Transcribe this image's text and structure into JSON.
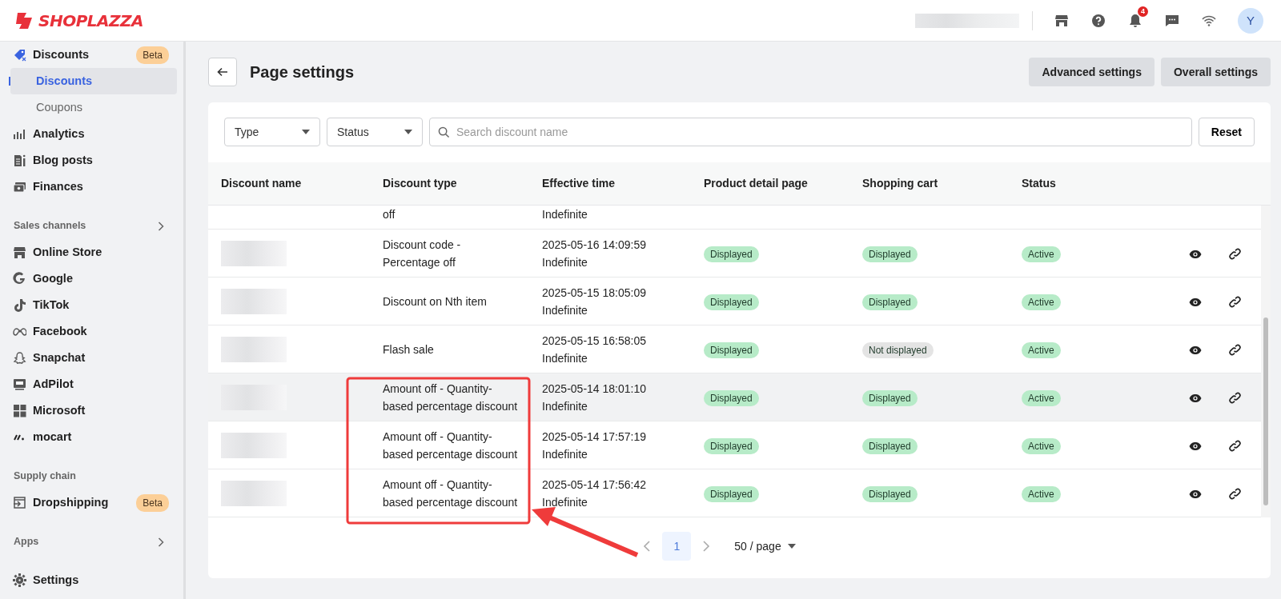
{
  "brand": {
    "name": "SHOPLAZZA"
  },
  "header": {
    "notification_count": "4",
    "avatar_initial": "Y"
  },
  "sidebar": {
    "items": [
      {
        "kind": "item",
        "label": "Discounts",
        "badge": "Beta",
        "selected": false
      },
      {
        "kind": "subitem",
        "label": "Discounts",
        "selected": true
      },
      {
        "kind": "subitem",
        "label": "Coupons",
        "selected": false
      },
      {
        "kind": "item",
        "label": "Analytics",
        "selected": false
      },
      {
        "kind": "item",
        "label": "Blog posts",
        "selected": false
      },
      {
        "kind": "item",
        "label": "Finances",
        "selected": false
      },
      {
        "kind": "section",
        "label": "Sales channels",
        "expandable": true
      },
      {
        "kind": "item",
        "label": "Online Store",
        "selected": false
      },
      {
        "kind": "item",
        "label": "Google",
        "selected": false
      },
      {
        "kind": "item",
        "label": "TikTok",
        "selected": false
      },
      {
        "kind": "item",
        "label": "Facebook",
        "selected": false
      },
      {
        "kind": "item",
        "label": "Snapchat",
        "selected": false
      },
      {
        "kind": "item",
        "label": "AdPilot",
        "selected": false
      },
      {
        "kind": "item",
        "label": "Microsoft",
        "selected": false
      },
      {
        "kind": "item",
        "label": "mocart",
        "selected": false
      },
      {
        "kind": "section",
        "label": "Supply chain",
        "expandable": false
      },
      {
        "kind": "item",
        "label": "Dropshipping",
        "badge": "Beta",
        "selected": false
      },
      {
        "kind": "section",
        "label": "Apps",
        "expandable": true
      },
      {
        "kind": "footer",
        "label": "Settings",
        "selected": false
      }
    ]
  },
  "page": {
    "title": "Page settings",
    "buttons": [
      "Advanced settings",
      "Overall settings"
    ]
  },
  "filters": {
    "type": "Type",
    "status": "Status",
    "search_placeholder": "Search discount name",
    "reset": "Reset"
  },
  "table": {
    "columns": [
      "Discount name",
      "Discount type",
      "Effective time",
      "Product detail page",
      "Shopping cart",
      "Status"
    ],
    "rows": [
      {
        "partial": true,
        "hovered": false,
        "type_lines": [
          "off"
        ],
        "time": [
          "Indefinite"
        ]
      },
      {
        "partial": false,
        "hovered": false,
        "type_lines": [
          "Discount code -",
          "Percentage off"
        ],
        "time": [
          "2025-05-16 14:09:59",
          "Indefinite"
        ],
        "product_page": {
          "text": "Displayed",
          "color": "#b7ebc8"
        },
        "cart": {
          "text": "Displayed",
          "color": "#b7ebc8"
        },
        "status": {
          "text": "Active",
          "color": "#b7ebc8"
        }
      },
      {
        "partial": false,
        "hovered": false,
        "type_lines": [
          "Discount on Nth item"
        ],
        "time": [
          "2025-05-15 18:05:09",
          "Indefinite"
        ],
        "product_page": {
          "text": "Displayed",
          "color": "#b7ebc8"
        },
        "cart": {
          "text": "Displayed",
          "color": "#b7ebc8"
        },
        "status": {
          "text": "Active",
          "color": "#b7ebc8"
        }
      },
      {
        "partial": false,
        "hovered": false,
        "type_lines": [
          "Flash sale"
        ],
        "time": [
          "2025-05-15 16:58:05",
          "Indefinite"
        ],
        "product_page": {
          "text": "Displayed",
          "color": "#b7ebc8"
        },
        "cart": {
          "text": "Not displayed",
          "color": "#e4e4e4"
        },
        "status": {
          "text": "Active",
          "color": "#b7ebc8"
        }
      },
      {
        "partial": false,
        "hovered": true,
        "type_lines": [
          "Amount off - Quantity-",
          "based percentage discount"
        ],
        "time": [
          "2025-05-14 18:01:10",
          "Indefinite"
        ],
        "product_page": {
          "text": "Displayed",
          "color": "#b7ebc8"
        },
        "cart": {
          "text": "Displayed",
          "color": "#b7ebc8"
        },
        "status": {
          "text": "Active",
          "color": "#b7ebc8"
        }
      },
      {
        "partial": false,
        "hovered": false,
        "type_lines": [
          "Amount off - Quantity-",
          "based percentage discount"
        ],
        "time": [
          "2025-05-14 17:57:19",
          "Indefinite"
        ],
        "product_page": {
          "text": "Displayed",
          "color": "#b7ebc8"
        },
        "cart": {
          "text": "Displayed",
          "color": "#b7ebc8"
        },
        "status": {
          "text": "Active",
          "color": "#b7ebc8"
        }
      },
      {
        "partial": false,
        "hovered": false,
        "type_lines": [
          "Amount off - Quantity-",
          "based percentage discount"
        ],
        "time": [
          "2025-05-14 17:56:42",
          "Indefinite"
        ],
        "product_page": {
          "text": "Displayed",
          "color": "#b7ebc8"
        },
        "cart": {
          "text": "Displayed",
          "color": "#b7ebc8"
        },
        "status": {
          "text": "Active",
          "color": "#b7ebc8"
        }
      }
    ]
  },
  "pagination": {
    "current": "1",
    "page_size": "50 / page"
  }
}
